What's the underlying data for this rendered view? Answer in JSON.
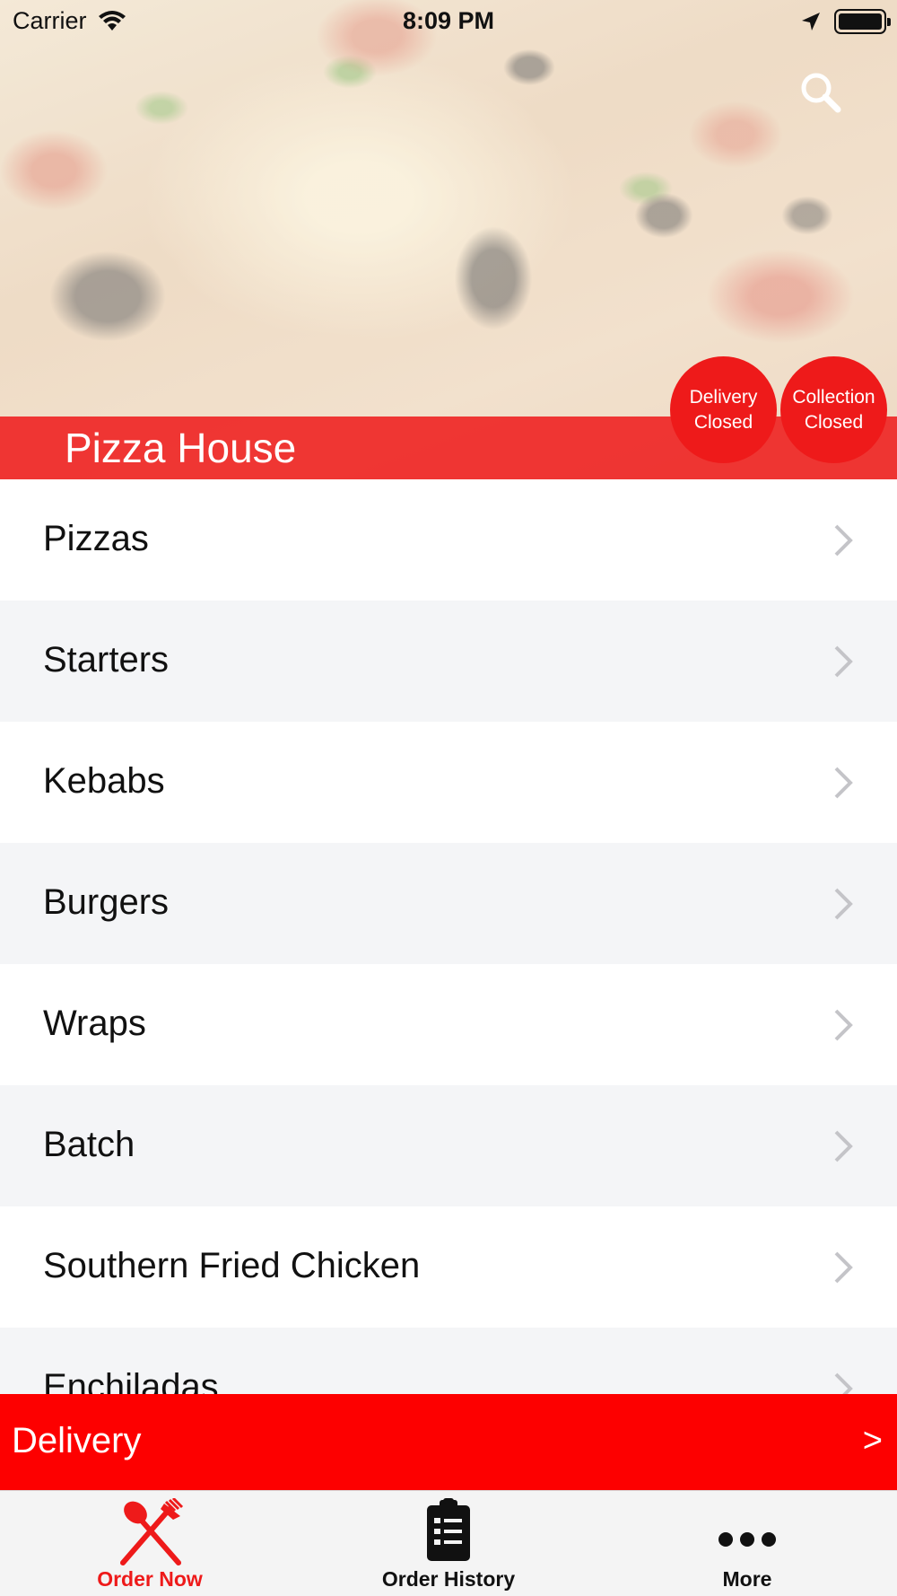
{
  "status_bar": {
    "carrier": "Carrier",
    "time": "8:09 PM"
  },
  "header": {
    "restaurant_name": "Pizza House",
    "search_icon": "search-icon"
  },
  "status_badges": {
    "delivery": {
      "line1": "Delivery",
      "line2": "Closed"
    },
    "collection": {
      "line1": "Collection",
      "line2": "Closed"
    }
  },
  "menu": {
    "items": [
      {
        "label": "Pizzas"
      },
      {
        "label": "Starters"
      },
      {
        "label": "Kebabs"
      },
      {
        "label": "Burgers"
      },
      {
        "label": "Wraps"
      },
      {
        "label": "Batch"
      },
      {
        "label": "Southern Fried Chicken"
      },
      {
        "label": "Enchiladas"
      }
    ]
  },
  "delivery_bar": {
    "label": "Delivery",
    "arrow": ">"
  },
  "tabs": [
    {
      "label": "Order Now",
      "icon": "fork-knife-icon",
      "active": true
    },
    {
      "label": "Order History",
      "icon": "clipboard-icon",
      "active": false
    },
    {
      "label": "More",
      "icon": "more-dots-icon",
      "active": false
    }
  ],
  "colors": {
    "accent": "#ee1a1a",
    "delivery_bar": "#fd0000",
    "alt_row": "#f4f5f7"
  }
}
